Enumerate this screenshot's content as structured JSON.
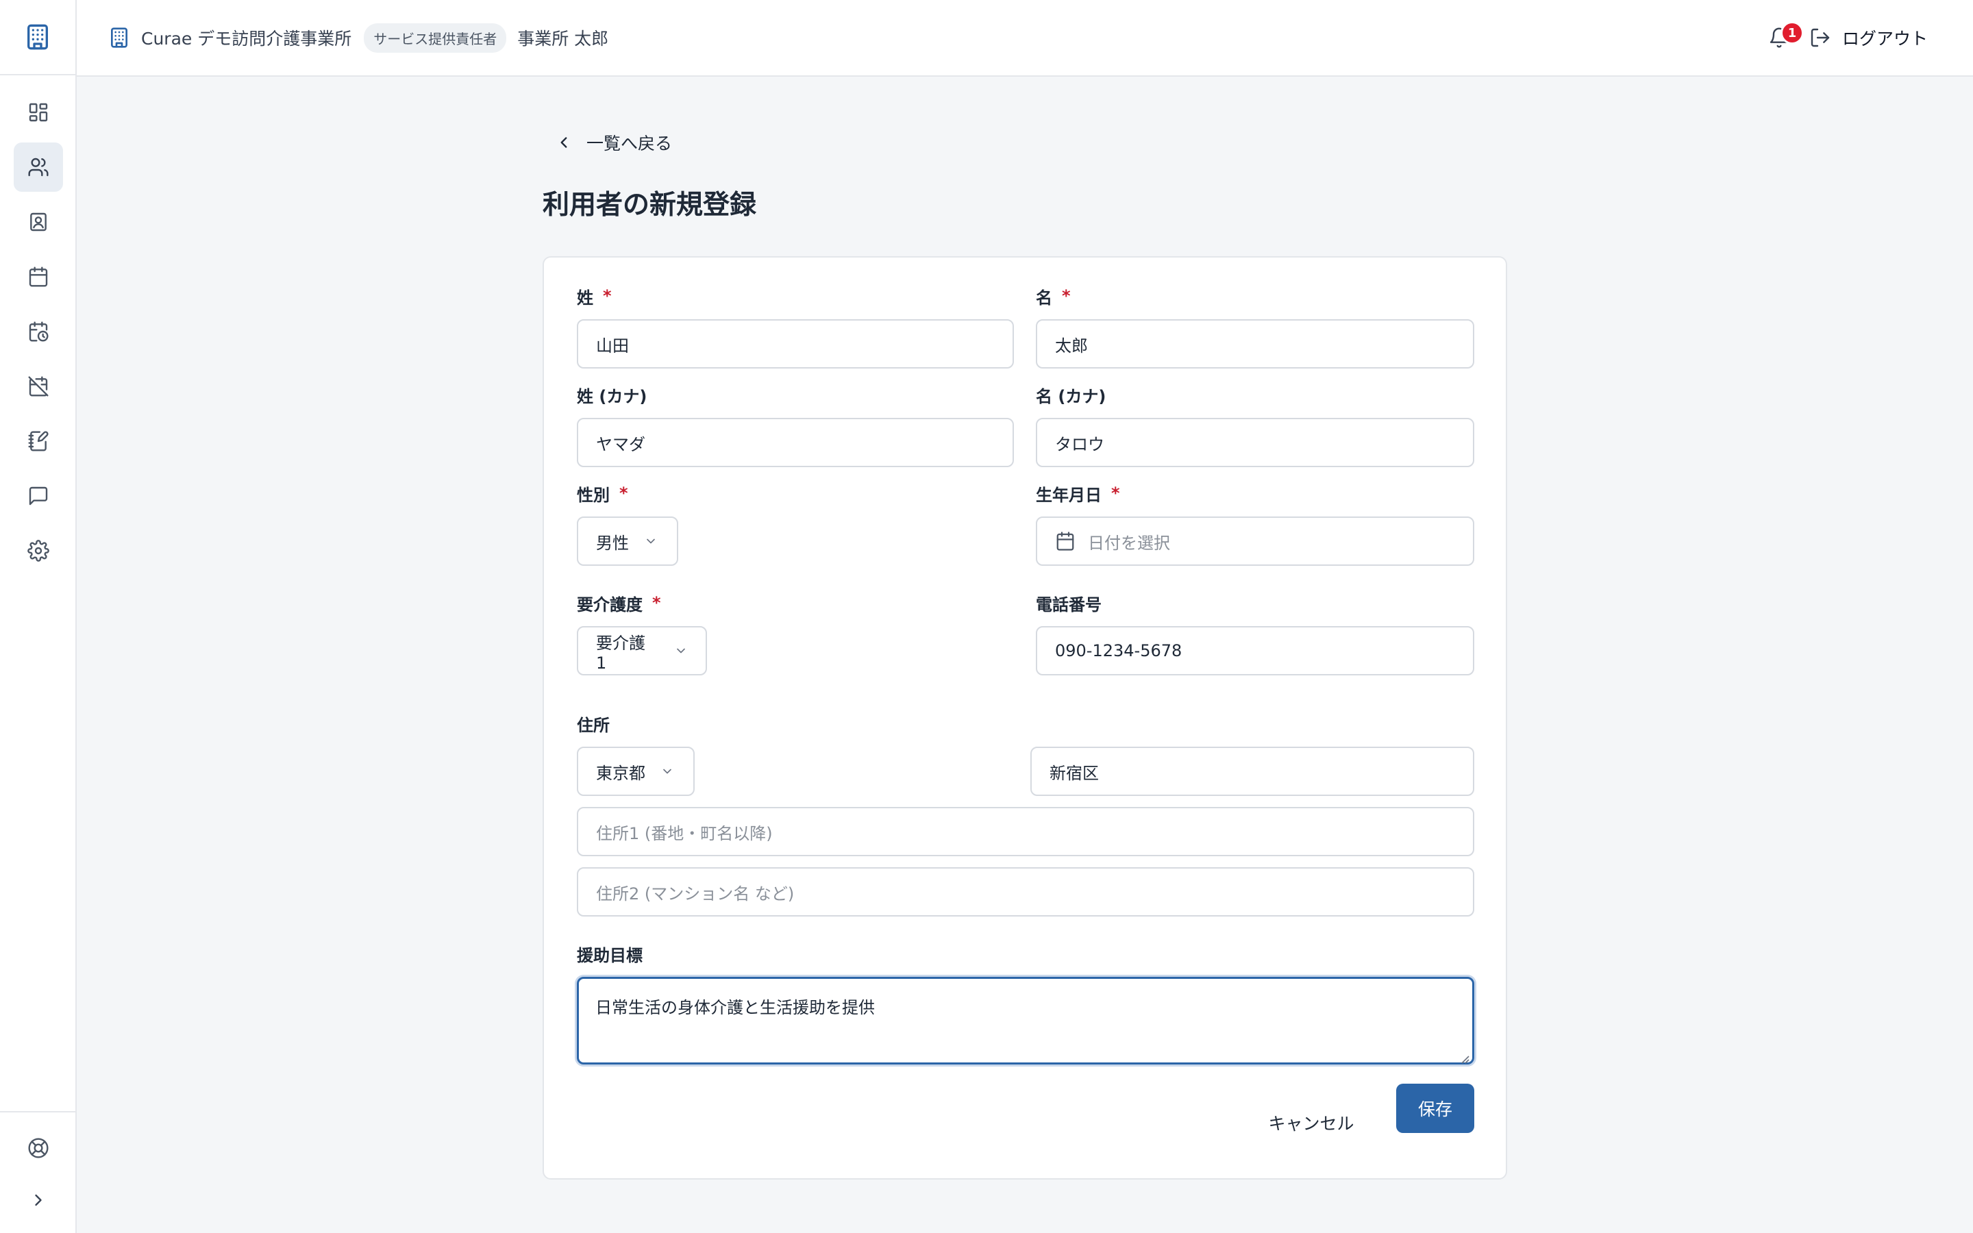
{
  "header": {
    "office_name": "Curae デモ訪問介護事業所",
    "role_badge": "サービス提供責任者",
    "user_name": "事業所 太郎",
    "notification_count": "1",
    "logout_label": "ログアウト"
  },
  "sidebar": {
    "items": [
      {
        "icon": "dashboard-icon"
      },
      {
        "icon": "users-icon",
        "active": true
      },
      {
        "icon": "contact-card-icon"
      },
      {
        "icon": "calendar-icon"
      },
      {
        "icon": "calendar-clock-icon"
      },
      {
        "icon": "calendar-off-icon"
      },
      {
        "icon": "notebook-pen-icon"
      },
      {
        "icon": "message-icon"
      },
      {
        "icon": "gear-icon"
      }
    ],
    "bottom": [
      {
        "icon": "help-buoy-icon"
      },
      {
        "icon": "chevron-right-icon"
      }
    ]
  },
  "nav": {
    "back_label": "一覧へ戻る"
  },
  "page": {
    "title": "利用者の新規登録"
  },
  "form": {
    "last_name": {
      "label": "姓",
      "required": "*",
      "value": "山田"
    },
    "first_name": {
      "label": "名",
      "required": "*",
      "value": "太郎"
    },
    "last_name_kana": {
      "label": "姓 (カナ)",
      "value": "ヤマダ"
    },
    "first_name_kana": {
      "label": "名 (カナ)",
      "value": "タロウ"
    },
    "gender": {
      "label": "性別",
      "required": "*",
      "value": "男性"
    },
    "birthdate": {
      "label": "生年月日",
      "required": "*",
      "placeholder": "日付を選択"
    },
    "care_level": {
      "label": "要介護度",
      "required": "*",
      "value": "要介護 1"
    },
    "phone": {
      "label": "電話番号",
      "value": "090-1234-5678"
    },
    "address": {
      "label": "住所",
      "prefecture": "東京都",
      "city": "新宿区",
      "line1_placeholder": "住所1 (番地・町名以降)",
      "line2_placeholder": "住所2 (マンション名 など)"
    },
    "goal": {
      "label": "援助目標",
      "value": "日常生活の身体介護と生活援助を提供"
    },
    "cancel_label": "キャンセル",
    "save_label": "保存"
  },
  "colors": {
    "accent": "#2b65a8",
    "required": "#c81e2e",
    "badge": "#e11d2e"
  }
}
